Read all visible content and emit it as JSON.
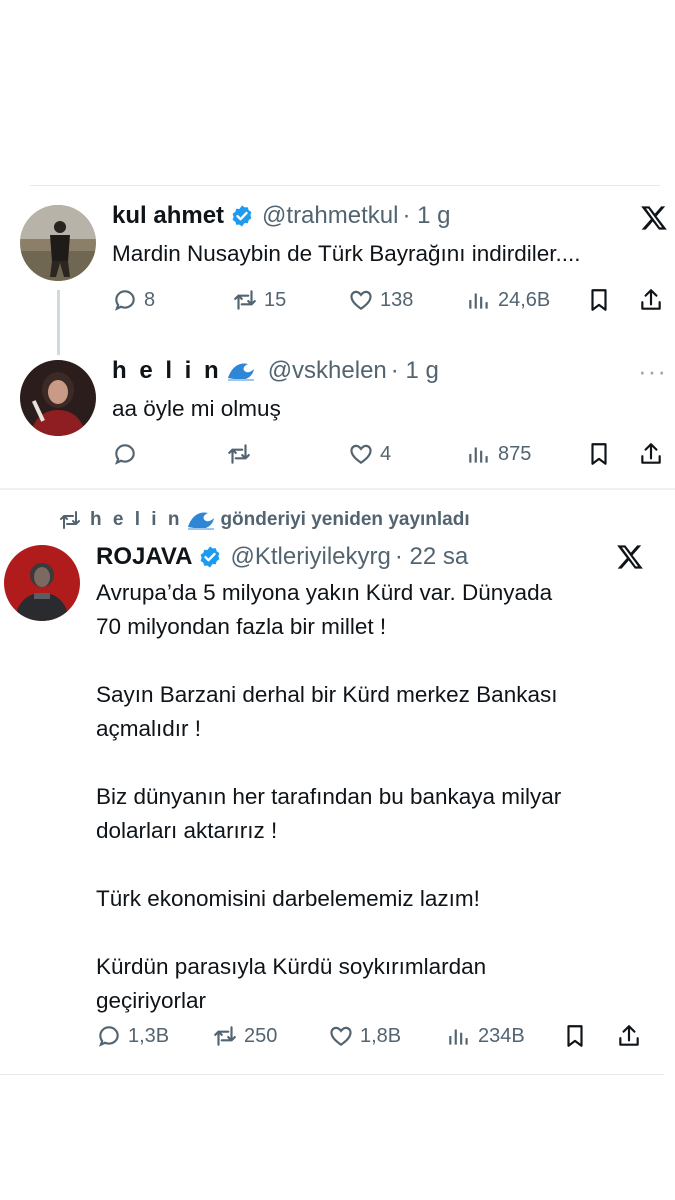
{
  "tweet1": {
    "name": "kul ahmet",
    "handle": "@trahmetkul",
    "time": "· 1 g",
    "text": "Mardin Nusaybin de Türk Bayrağını indirdiler....",
    "replies": "8",
    "reposts": "15",
    "likes": "138",
    "views": "24,6B"
  },
  "tweet2": {
    "name": "h e l i n",
    "handle": "@vskhelen",
    "time": "· 1 g",
    "text": "aa öyle mi olmuş",
    "replies": "",
    "reposts": "",
    "likes": "4",
    "views": "875",
    "more": "···"
  },
  "repost_notice": {
    "user": "h e l i n",
    "text": "gönderiyi yeniden yayınladı"
  },
  "tweet3": {
    "name": "ROJAVA",
    "handle": "@Ktleriyilekyrg",
    "time": "· 22 sa",
    "text": "Avrupa’da 5 milyona yakın Kürd var. Dünyada\n70 milyondan fazla bir millet !\n\nSayın Barzani derhal bir Kürd merkez Bankası\naçmalıdır !\n\nBiz dünyanın her tarafından bu bankaya milyar\ndolarları aktarırız !\n\nTürk ekonomisini darbelememiz lazım!\n\nKürdün parasıyla Kürdü soykırımlardan\ngeçiriyorlar",
    "replies": "1,3B",
    "reposts": "250",
    "likes": "1,8B",
    "views": "234B"
  },
  "colors": {
    "verified": "#1d9bf0",
    "secondary": "#536471",
    "divider": "#e6e9ec"
  }
}
